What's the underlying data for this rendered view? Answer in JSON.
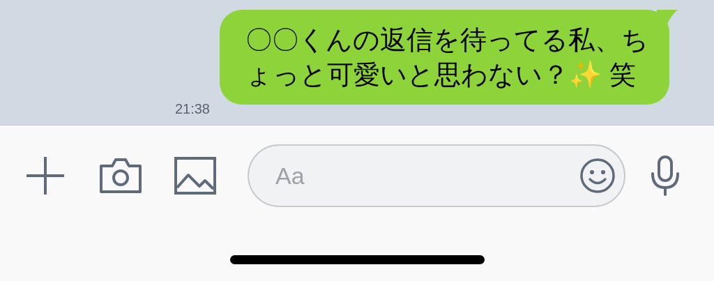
{
  "message": {
    "text": "〇〇くんの返信を待ってる私、ちょっと可愛いと思わない？✨ 笑",
    "time": "21:38"
  },
  "input": {
    "placeholder": "Aa"
  }
}
